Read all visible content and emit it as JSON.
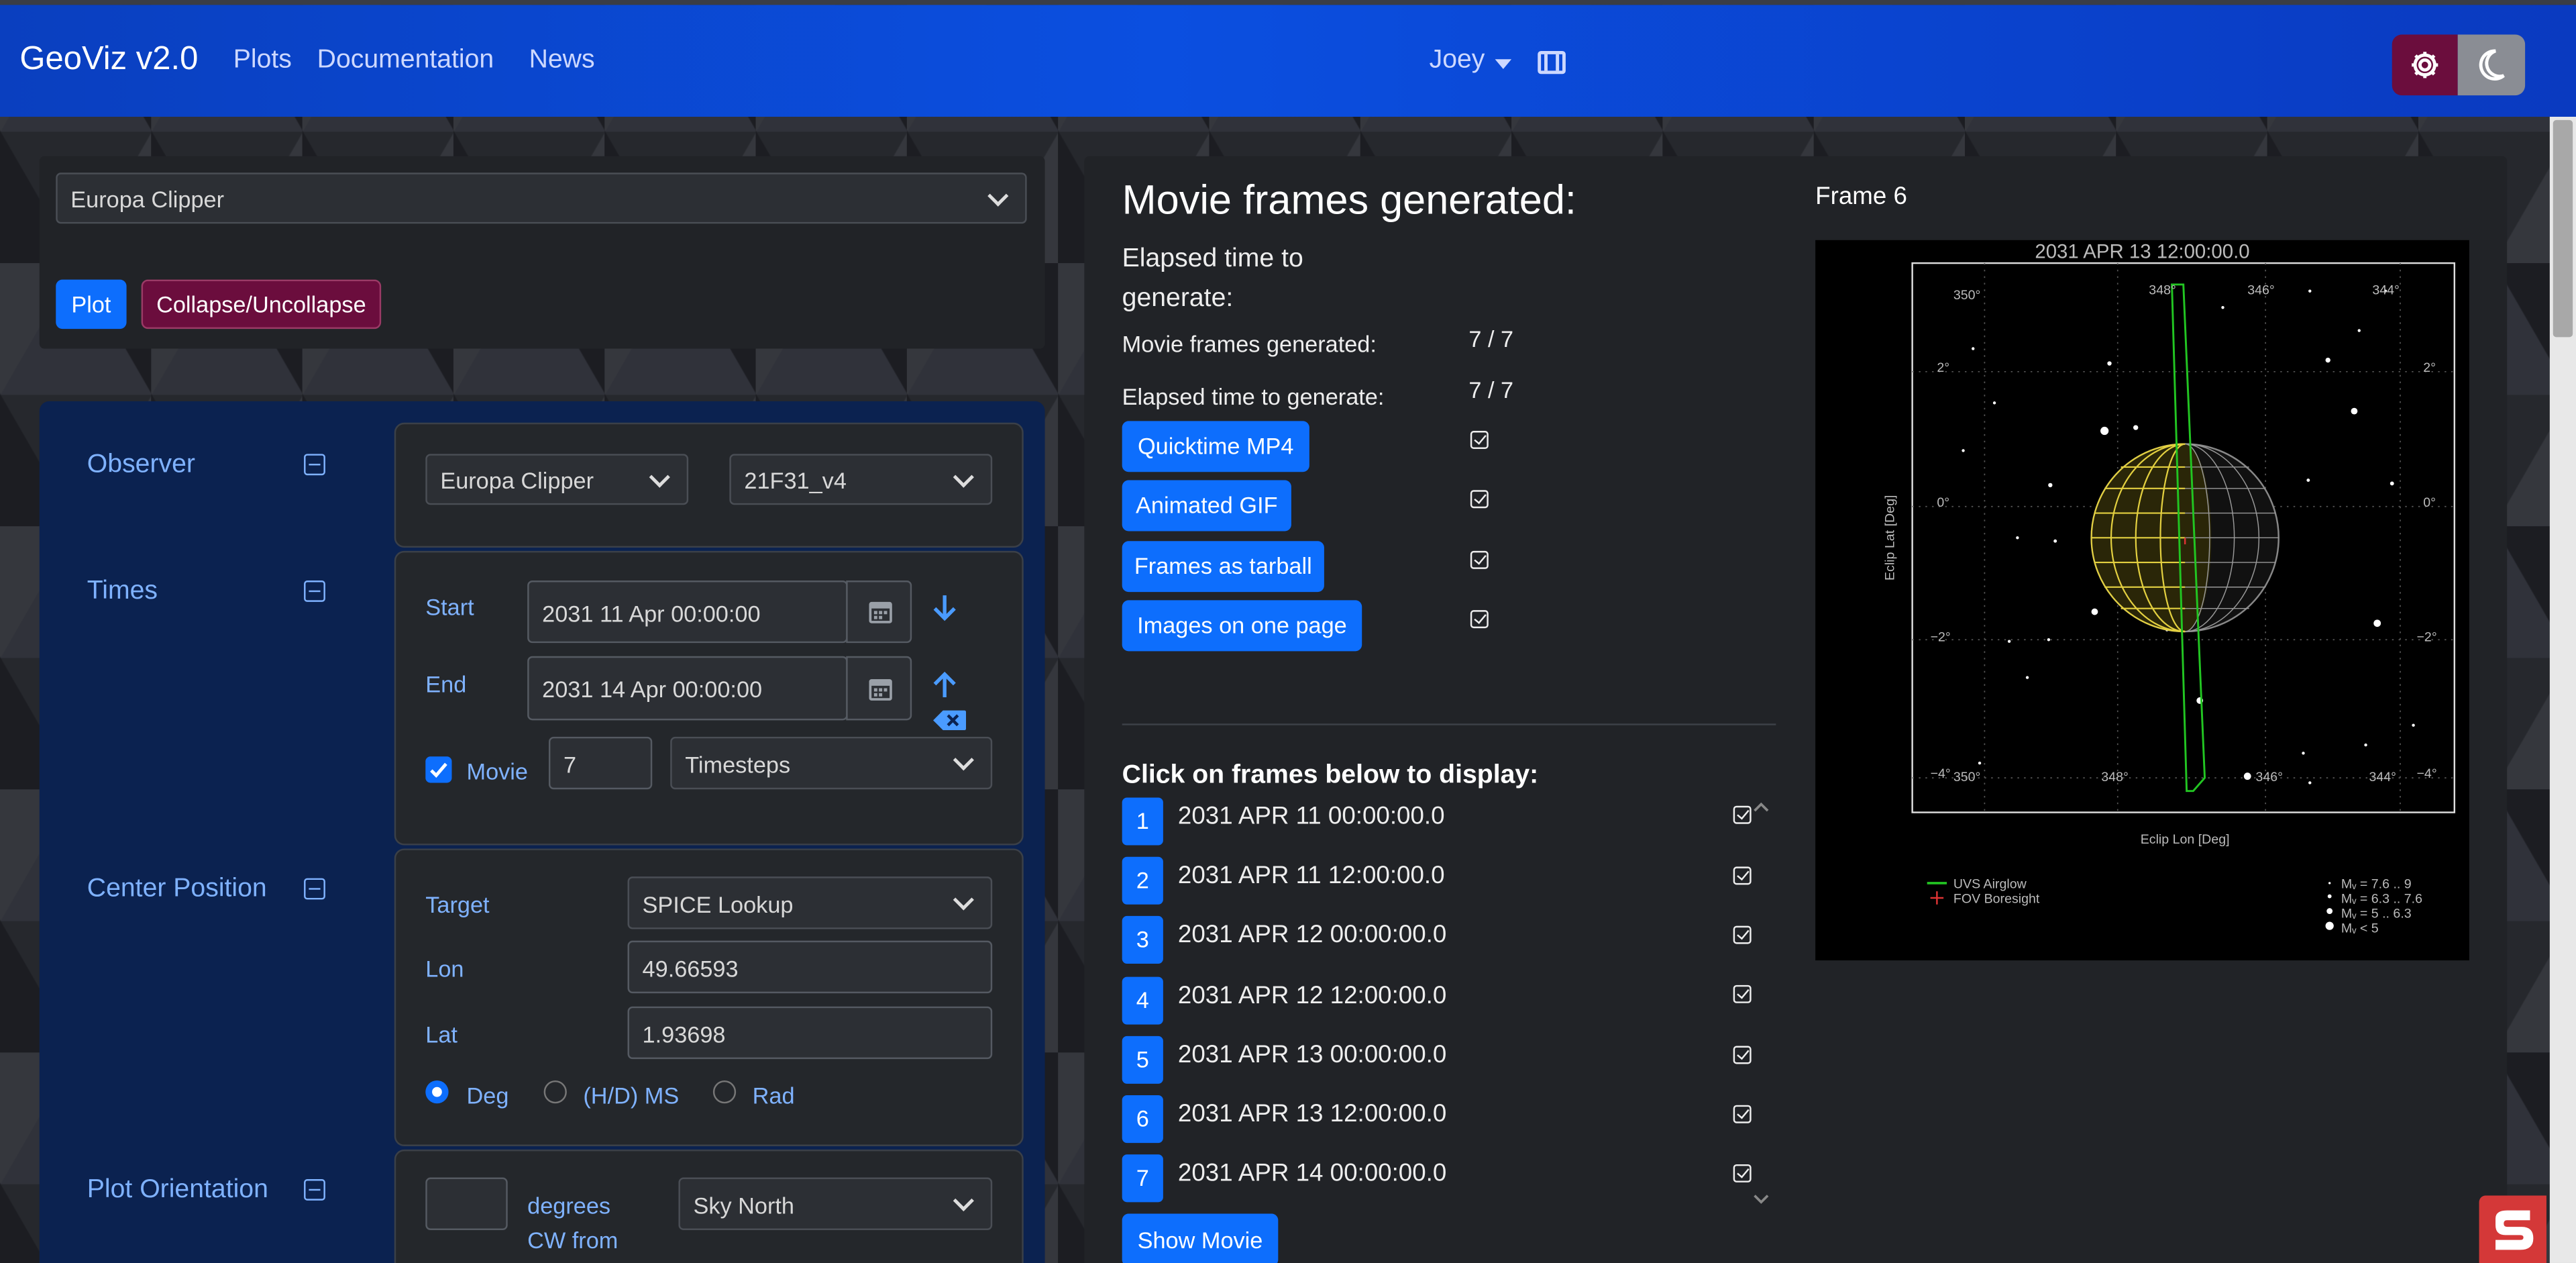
{
  "nav": {
    "brand": "GeoViz v2.0",
    "links": [
      "Plots",
      "Documentation",
      "News"
    ],
    "user": "Joey"
  },
  "top_panel": {
    "spacecraft": "Europa Clipper",
    "plot_label": "Plot",
    "collapse_label": "Collapse/Uncollapse"
  },
  "observer": {
    "label": "Observer",
    "body": "Europa Clipper",
    "kernel": "21F31_v4"
  },
  "times": {
    "label": "Times",
    "start_label": "Start",
    "start": "2031 11 Apr 00:00:00",
    "end_label": "End",
    "end": "2031 14 Apr 00:00:00",
    "movie_label": "Movie",
    "movie_count": "7",
    "step_mode": "Timesteps"
  },
  "center": {
    "label": "Center Position",
    "target_label": "Target",
    "target": "SPICE Lookup",
    "lon_label": "Lon",
    "lon": "49.66593",
    "lat_label": "Lat",
    "lat": "1.93698",
    "units": [
      "Deg",
      "(H/D) MS",
      "Rad"
    ],
    "selected_unit": "Deg"
  },
  "orientation": {
    "label": "Plot Orientation",
    "degrees_label": "degrees",
    "cw_label": "CW from",
    "reference": "Sky North"
  },
  "results": {
    "heading": "Movie frames generated:",
    "elapsed_heading": "Elapsed time to generate:",
    "rows": [
      {
        "label": "Movie frames generated:",
        "value": "7 / 7"
      },
      {
        "label": "Elapsed time to generate:",
        "value": "7 / 7"
      }
    ],
    "downloads": [
      "Quicktime MP4",
      "Animated GIF",
      "Frames as tarball",
      "Images on one page"
    ],
    "click_heading": "Click on frames below to display:",
    "frames": [
      {
        "n": "1",
        "time": "2031 APR 11 00:00:00.0"
      },
      {
        "n": "2",
        "time": "2031 APR 11 12:00:00.0"
      },
      {
        "n": "3",
        "time": "2031 APR 12 00:00:00.0"
      },
      {
        "n": "4",
        "time": "2031 APR 12 12:00:00.0"
      },
      {
        "n": "5",
        "time": "2031 APR 13 00:00:00.0"
      },
      {
        "n": "6",
        "time": "2031 APR 13 12:00:00.0"
      },
      {
        "n": "7",
        "time": "2031 APR 14 00:00:00.0"
      }
    ],
    "show_movie": "Show Movie"
  },
  "preview": {
    "frame_label": "Frame 6",
    "plot_title": "2031 APR 13 12:00:00.0",
    "xlabel": "Eclip Lon [Deg]",
    "ylabel": "Eclip Lat [Deg]",
    "xticks": [
      "350°",
      "348°",
      "346°",
      "344°"
    ],
    "yticks": [
      "2°",
      "0°",
      "−2°",
      "−4°"
    ],
    "legend": [
      "UVS Airglow",
      "FOV Boresight"
    ],
    "mag_legend": [
      "Mᵥ = 7.6 .. 9",
      "Mᵥ = 6.3 .. 7.6",
      "Mᵥ = 5 .. 6.3",
      "Mᵥ < 5"
    ]
  },
  "colors": {
    "accent": "#0d6efd",
    "crimson": "#6b0d3d",
    "nav": "#0b4fe0"
  }
}
